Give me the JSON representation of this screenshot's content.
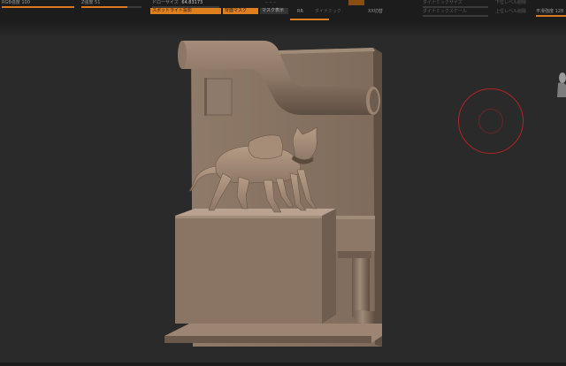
{
  "toolbar": {
    "rgb_intensity": "RGB強度 100",
    "z_intensity": "Z強度 51",
    "draw_size_label": "ドローサイズ",
    "draw_size_value": "64.83173",
    "spotlight_projection": "スポットライト投影",
    "backface_mask": "背面マスク",
    "mask_display": "マスク表示",
    "rr_label": "RR",
    "dynamic_label": "ダイナミック",
    "dynamic_size_label": "ダイナミックサイズ",
    "dynamic_scale_label": "ダイナミックスケール",
    "subdiv_lower": "下位レベル削除",
    "subdiv_higher": "上位レベル削除",
    "smooth_strength": "平滑強度 128",
    "frame_switch": "XX切替"
  },
  "colors": {
    "toolbar_bg": "#1c1c1c",
    "viewport_bg": "#2a2a2a",
    "accent_orange": "#e07f1e",
    "brush_circle": "#b32424",
    "model_clay": "#8a7565"
  },
  "viewport": {
    "model": "diorama-cat-on-box",
    "cursor": "brush-circle"
  }
}
